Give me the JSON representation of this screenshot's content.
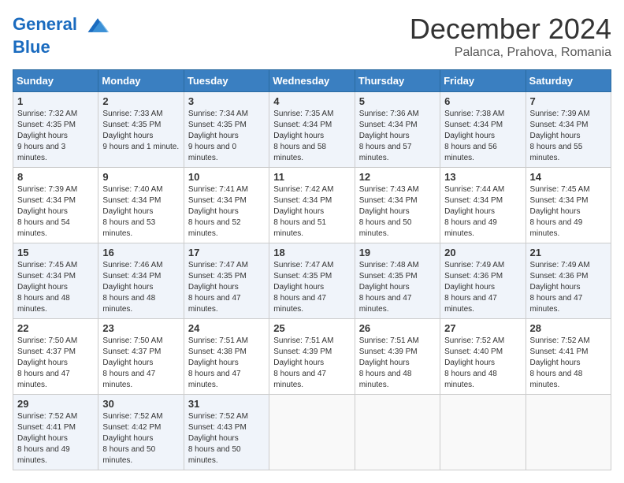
{
  "header": {
    "logo_line1": "General",
    "logo_line2": "Blue",
    "month": "December 2024",
    "location": "Palanca, Prahova, Romania"
  },
  "weekdays": [
    "Sunday",
    "Monday",
    "Tuesday",
    "Wednesday",
    "Thursday",
    "Friday",
    "Saturday"
  ],
  "weeks": [
    [
      {
        "day": "1",
        "sunrise": "7:32 AM",
        "sunset": "4:35 PM",
        "daylight": "9 hours and 3 minutes."
      },
      {
        "day": "2",
        "sunrise": "7:33 AM",
        "sunset": "4:35 PM",
        "daylight": "9 hours and 1 minute."
      },
      {
        "day": "3",
        "sunrise": "7:34 AM",
        "sunset": "4:35 PM",
        "daylight": "9 hours and 0 minutes."
      },
      {
        "day": "4",
        "sunrise": "7:35 AM",
        "sunset": "4:34 PM",
        "daylight": "8 hours and 58 minutes."
      },
      {
        "day": "5",
        "sunrise": "7:36 AM",
        "sunset": "4:34 PM",
        "daylight": "8 hours and 57 minutes."
      },
      {
        "day": "6",
        "sunrise": "7:38 AM",
        "sunset": "4:34 PM",
        "daylight": "8 hours and 56 minutes."
      },
      {
        "day": "7",
        "sunrise": "7:39 AM",
        "sunset": "4:34 PM",
        "daylight": "8 hours and 55 minutes."
      }
    ],
    [
      {
        "day": "8",
        "sunrise": "7:39 AM",
        "sunset": "4:34 PM",
        "daylight": "8 hours and 54 minutes."
      },
      {
        "day": "9",
        "sunrise": "7:40 AM",
        "sunset": "4:34 PM",
        "daylight": "8 hours and 53 minutes."
      },
      {
        "day": "10",
        "sunrise": "7:41 AM",
        "sunset": "4:34 PM",
        "daylight": "8 hours and 52 minutes."
      },
      {
        "day": "11",
        "sunrise": "7:42 AM",
        "sunset": "4:34 PM",
        "daylight": "8 hours and 51 minutes."
      },
      {
        "day": "12",
        "sunrise": "7:43 AM",
        "sunset": "4:34 PM",
        "daylight": "8 hours and 50 minutes."
      },
      {
        "day": "13",
        "sunrise": "7:44 AM",
        "sunset": "4:34 PM",
        "daylight": "8 hours and 49 minutes."
      },
      {
        "day": "14",
        "sunrise": "7:45 AM",
        "sunset": "4:34 PM",
        "daylight": "8 hours and 49 minutes."
      }
    ],
    [
      {
        "day": "15",
        "sunrise": "7:45 AM",
        "sunset": "4:34 PM",
        "daylight": "8 hours and 48 minutes."
      },
      {
        "day": "16",
        "sunrise": "7:46 AM",
        "sunset": "4:34 PM",
        "daylight": "8 hours and 48 minutes."
      },
      {
        "day": "17",
        "sunrise": "7:47 AM",
        "sunset": "4:35 PM",
        "daylight": "8 hours and 47 minutes."
      },
      {
        "day": "18",
        "sunrise": "7:47 AM",
        "sunset": "4:35 PM",
        "daylight": "8 hours and 47 minutes."
      },
      {
        "day": "19",
        "sunrise": "7:48 AM",
        "sunset": "4:35 PM",
        "daylight": "8 hours and 47 minutes."
      },
      {
        "day": "20",
        "sunrise": "7:49 AM",
        "sunset": "4:36 PM",
        "daylight": "8 hours and 47 minutes."
      },
      {
        "day": "21",
        "sunrise": "7:49 AM",
        "sunset": "4:36 PM",
        "daylight": "8 hours and 47 minutes."
      }
    ],
    [
      {
        "day": "22",
        "sunrise": "7:50 AM",
        "sunset": "4:37 PM",
        "daylight": "8 hours and 47 minutes."
      },
      {
        "day": "23",
        "sunrise": "7:50 AM",
        "sunset": "4:37 PM",
        "daylight": "8 hours and 47 minutes."
      },
      {
        "day": "24",
        "sunrise": "7:51 AM",
        "sunset": "4:38 PM",
        "daylight": "8 hours and 47 minutes."
      },
      {
        "day": "25",
        "sunrise": "7:51 AM",
        "sunset": "4:39 PM",
        "daylight": "8 hours and 47 minutes."
      },
      {
        "day": "26",
        "sunrise": "7:51 AM",
        "sunset": "4:39 PM",
        "daylight": "8 hours and 48 minutes."
      },
      {
        "day": "27",
        "sunrise": "7:52 AM",
        "sunset": "4:40 PM",
        "daylight": "8 hours and 48 minutes."
      },
      {
        "day": "28",
        "sunrise": "7:52 AM",
        "sunset": "4:41 PM",
        "daylight": "8 hours and 48 minutes."
      }
    ],
    [
      {
        "day": "29",
        "sunrise": "7:52 AM",
        "sunset": "4:41 PM",
        "daylight": "8 hours and 49 minutes."
      },
      {
        "day": "30",
        "sunrise": "7:52 AM",
        "sunset": "4:42 PM",
        "daylight": "8 hours and 50 minutes."
      },
      {
        "day": "31",
        "sunrise": "7:52 AM",
        "sunset": "4:43 PM",
        "daylight": "8 hours and 50 minutes."
      },
      null,
      null,
      null,
      null
    ]
  ],
  "labels": {
    "sunrise": "Sunrise:",
    "sunset": "Sunset:",
    "daylight": "Daylight hours"
  }
}
